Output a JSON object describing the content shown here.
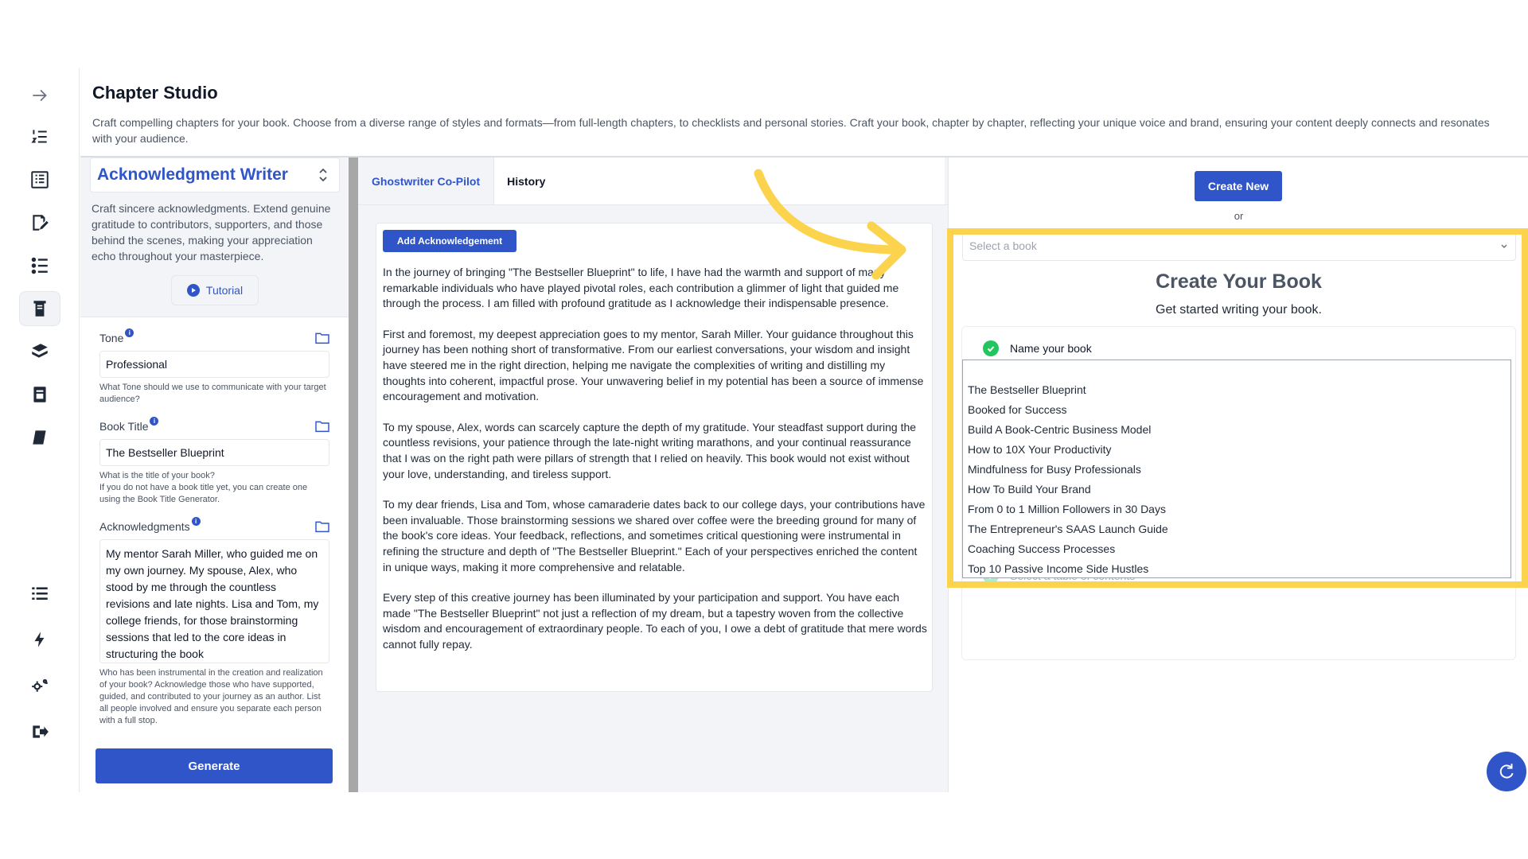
{
  "header": {
    "title": "Chapter Studio",
    "description": "Craft compelling chapters for your book. Choose from a diverse range of styles and formats—from full-length chapters, to checklists and personal stories. Craft your book, chapter by chapter, reflecting your unique voice and brand, ensuring your content deeply connects and resonates with your audience."
  },
  "rail": {
    "items": [
      "expand-arrow-icon",
      "numbered-list-icon",
      "outline-icon",
      "edit-document-icon",
      "checklist-icon",
      "book-scroll-icon",
      "stack-books-icon",
      "book-cover-icon",
      "notebook-icon",
      "list-icon",
      "lightning-icon",
      "settings-gear-icon",
      "logout-icon"
    ],
    "active_index": 5
  },
  "form": {
    "writer_name": "Acknowledgment Writer",
    "writer_description": "Craft sincere acknowledgments. Extend genuine gratitude to contributors, supporters, and those behind the scenes, making your appreciation echo throughout your masterpiece.",
    "tutorial_label": "Tutorial",
    "tone": {
      "label": "Tone",
      "value": "Professional",
      "hint": "What Tone should we use to communicate with your target audience?"
    },
    "book_title": {
      "label": "Book Title",
      "value": "The Bestseller Blueprint",
      "hint": "What is the title of your book?\nIf you do not have a book title yet, you can create one using the Book Title Generator."
    },
    "acknowledgments": {
      "label": "Acknowledgments",
      "value": "My mentor Sarah Miller, who guided me on my own journey. My spouse, Alex, who stood by me through the countless revisions and late nights. Lisa and Tom, my college friends, for those brainstorming sessions that led to the core ideas in structuring the book",
      "hint": "Who has been instrumental in the creation and realization of your book? Acknowledge those who have supported, guided, and contributed to your journey as an author. List all people involved and ensure you separate each person with a full stop."
    },
    "generate_label": "Generate"
  },
  "middle": {
    "tabs": [
      {
        "label": "Ghostwriter Co-Pilot"
      },
      {
        "label": "History"
      }
    ],
    "add_button_label": "Add Acknowledgement",
    "paragraphs": [
      "In the journey of bringing \"The Bestseller Blueprint\" to life, I have had the warmth and support of many remarkable individuals who have played pivotal roles, each contribution a glimmer of light that guided me through the process. I am filled with profound gratitude as I acknowledge their indispensable presence.",
      "First and foremost, my deepest appreciation goes to my mentor, Sarah Miller. Your guidance throughout this journey has been nothing short of transformative. From our earliest conversations, your wisdom and insight have steered me in the right direction, helping me navigate the complexities of writing and distilling my thoughts into coherent, impactful prose. Your unwavering belief in my potential has been a source of immense encouragement and motivation.",
      "To my spouse, Alex, words can scarcely capture the depth of my gratitude. Your steadfast support during the countless revisions, your patience through the late-night writing marathons, and your continual reassurance that I was on the right path were pillars of strength that I relied on heavily. This book would not exist without your love, understanding, and tireless support.",
      "To my dear friends, Lisa and Tom, whose camaraderie dates back to our college days, your contributions have been invaluable. Those brainstorming sessions we shared over coffee were the breeding ground for many of the book's core ideas. Your feedback, reflections, and sometimes critical questioning were instrumental in refining the structure and depth of \"The Bestseller Blueprint.\" Each of your perspectives enriched the content in unique ways, making it more comprehensive and relatable.",
      "Every step of this creative journey has been illuminated by your participation and support. You have each made \"The Bestseller Blueprint\" not just a reflection of my dream, but a tapestry woven from the collective wisdom and encouragement of extraordinary people. To each of you, I owe a debt of gratitude that mere words cannot fully repay."
    ]
  },
  "right": {
    "create_new_label": "Create New",
    "or_label": "or",
    "select_book_placeholder": "Select a book",
    "create_title": "Create Your Book",
    "create_subtitle": "Get started writing your book.",
    "step_name_label": "Name your book",
    "step_toc_label": "Select a table of contents",
    "book_options": [
      "The Bestseller Blueprint",
      "Booked for Success",
      "Build A Book-Centric Business Model",
      "How to 10X Your Productivity",
      "Mindfulness for Busy Professionals",
      "How To Build Your Brand",
      "From 0 to 1 Million Followers in 30 Days",
      "The Entrepreneur's SAAS Launch Guide",
      "Coaching Success Processes",
      "Top 10 Passive Income Side Hustles"
    ]
  },
  "colors": {
    "accent": "#2f55c9",
    "highlight": "#fcd34d",
    "success": "#22c55e"
  }
}
